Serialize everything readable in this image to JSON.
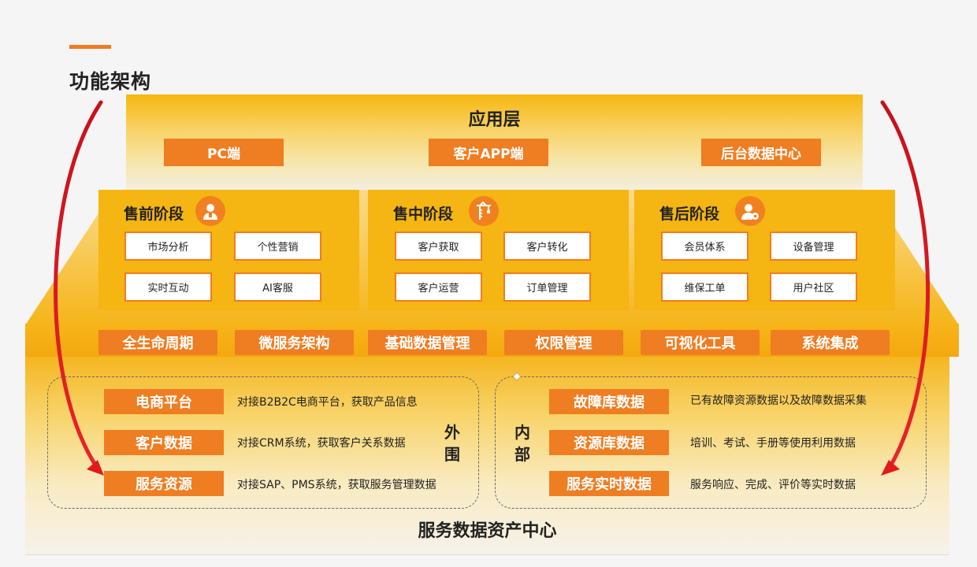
{
  "page": {
    "title": "功能架构"
  },
  "app_layer": {
    "title": "应用层",
    "buttons": [
      "PC端",
      "客户APP端",
      "后台数据中心"
    ]
  },
  "stages": [
    {
      "title": "售前阶段",
      "icon": "person-icon",
      "items": [
        "市场分析",
        "个性营销",
        "实时互动",
        "AI客服"
      ]
    },
    {
      "title": "售中阶段",
      "icon": "crane-icon",
      "items": [
        "客户获取",
        "客户转化",
        "客户运营",
        "订单管理"
      ]
    },
    {
      "title": "售后阶段",
      "icon": "user-settings-icon",
      "items": [
        "会员体系",
        "设备管理",
        "维保工单",
        "用户社区"
      ]
    }
  ],
  "mid_band": [
    "全生命周期",
    "微服务架构",
    "基础数据管理",
    "权限管理",
    "可视化工具",
    "系统集成"
  ],
  "external": {
    "label": "外围",
    "rows": [
      {
        "name": "电商平台",
        "desc": "对接B2B2C电商平台，获取产品信息"
      },
      {
        "name": "客户数据",
        "desc": "对接CRM系统，获取客户关系数据"
      },
      {
        "name": "服务资源",
        "desc": "对接SAP、PMS系统，获取服务管理数据"
      }
    ]
  },
  "internal": {
    "label": "内部",
    "rows": [
      {
        "name": "故障库数据",
        "desc": "已有故障资源数据以及故障数据采集"
      },
      {
        "name": "资源库数据",
        "desc": "培训、考试、手册等使用利用数据"
      },
      {
        "name": "服务实时数据",
        "desc": "服务响应、完成、评价等实时数据"
      }
    ]
  },
  "data_center": {
    "title": "服务数据资产中心"
  },
  "colors": {
    "accent": "#ef7d21",
    "band": "#f5b512",
    "arrow": "#e01b1b"
  }
}
